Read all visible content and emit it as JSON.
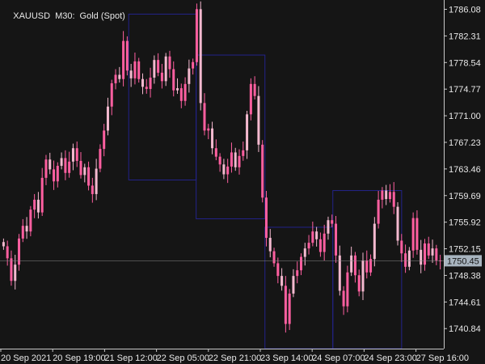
{
  "header": {
    "symbol": "XAUUSD",
    "timeframe": "M30:",
    "instrument": "Gold (Spot)"
  },
  "chart_data": {
    "type": "candlestick",
    "title": "",
    "ylim": [
      1738.0,
      1787.4
    ],
    "y_ticks": [
      "1786.08",
      "1782.31",
      "1778.54",
      "1774.77",
      "1771.00",
      "1767.23",
      "1763.46",
      "1759.69",
      "1755.92",
      "1752.15",
      "1748.38",
      "1744.61",
      "1740.84"
    ],
    "x_ticks": [
      "20 Sep 2021",
      "20 Sep 19:00",
      "21 Sep 12:00",
      "22 Sep 05:00",
      "22 Sep 21:00",
      "23 Sep 14:00",
      "24 Sep 07:00",
      "24 Sep 23:00",
      "27 Sep 16:00"
    ],
    "current_price": "1750.45",
    "grid": false,
    "colors": {
      "background": "#151515",
      "candle": "#ff5fa0",
      "candle_alt": "#f4b9cf",
      "axis": "#c8c8c8",
      "box": "#23238a",
      "price_line": "#8a8a8a",
      "price_tag": "#a8b4bf"
    },
    "range_boxes": [
      {
        "x_start": 0.29,
        "x_end": 0.442,
        "y_high": 1785.4,
        "y_low": 1761.9
      },
      {
        "x_start": 0.442,
        "x_end": 0.597,
        "y_high": 1779.6,
        "y_low": 1756.4
      },
      {
        "x_start": 0.597,
        "x_end": 0.75,
        "y_high": 1755.2,
        "y_low": 1738.0
      },
      {
        "x_start": 0.75,
        "x_end": 0.905,
        "y_high": 1760.4,
        "y_low": 1738.0
      }
    ],
    "series": [
      {
        "close": [
          1752.5,
          1750.8,
          1747.6,
          1749.9,
          1753.6,
          1755.4,
          1754.6,
          1757.7,
          1759.1,
          1757.3,
          1762.2,
          1764.8,
          1763.4,
          1761.7,
          1763.9,
          1765.0,
          1762.9,
          1764.5,
          1766.4,
          1764.6,
          1762.6,
          1763.7,
          1761.1,
          1759.9,
          1763.5,
          1766.3,
          1768.9,
          1772.3,
          1775.6,
          1776.8,
          1776.2,
          1781.6,
          1777.4,
          1776.3,
          1778.7,
          1776.2,
          1775.1,
          1774.8,
          1776.4,
          1778.9,
          1777.1,
          1775.9,
          1779.4,
          1777.6,
          1774.6,
          1774.9,
          1773.1,
          1775.5,
          1777.7,
          1778.6,
          1786.1,
          1772.8,
          1768.9,
          1769.2,
          1766.4,
          1765.2,
          1764.1,
          1762.7,
          1763.8,
          1765.8,
          1763.7,
          1765.3,
          1766.1,
          1771.2,
          1775.5,
          1773.8,
          1766.9,
          1759.4,
          1753.7,
          1751.8,
          1750.1,
          1748.3,
          1746.9,
          1741.5,
          1745.8,
          1748.3,
          1749.1,
          1751.0,
          1752.2,
          1753.0,
          1754.6,
          1753.5,
          1751.7,
          1754.3,
          1756.2,
          1755.7,
          1751.2,
          1746.2,
          1744.0,
          1748.8,
          1751.2,
          1748.4,
          1746.1,
          1750.5,
          1748.8,
          1750.7,
          1755.7,
          1759.1,
          1760.4,
          1759.2,
          1760.2,
          1758.1,
          1753.3,
          1751.5,
          1749.6,
          1751.9,
          1756.5,
          1752.0,
          1749.9,
          1752.9,
          1751.2,
          1752.2,
          1750.5,
          1750.45
        ]
      }
    ]
  }
}
